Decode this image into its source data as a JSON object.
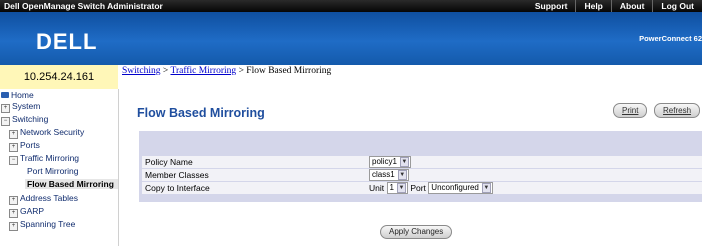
{
  "topbar": {
    "app_title": "Dell OpenManage Switch Administrator",
    "links": [
      "Support",
      "Help",
      "About",
      "Log Out"
    ]
  },
  "brand": {
    "logo": "DELL",
    "product": "PowerConnect 62"
  },
  "ip_address": "10.254.24.161",
  "breadcrumb": {
    "items": [
      "Switching",
      "Traffic Mirroring"
    ],
    "separator": ">",
    "current": "Flow Based Mirroring"
  },
  "tree": [
    {
      "label": "Home",
      "icon": "home-icon"
    },
    {
      "label": "System",
      "icon": "expand-icon"
    },
    {
      "label": "Switching",
      "icon": "collapse-icon"
    },
    {
      "label": "Network Security",
      "icon": "expand-icon"
    },
    {
      "label": "Ports",
      "icon": "expand-icon"
    },
    {
      "label": "Traffic Mirroring",
      "icon": "collapse-icon"
    },
    {
      "label": "Port Mirroring",
      "icon": "leaf-icon"
    },
    {
      "label": "Flow Based Mirroring",
      "icon": "leaf-icon",
      "selected": true
    },
    {
      "label": "Address Tables",
      "icon": "expand-icon"
    },
    {
      "label": "GARP",
      "icon": "expand-icon"
    },
    {
      "label": "Spanning Tree",
      "icon": "expand-icon"
    }
  ],
  "page": {
    "title": "Flow Based Mirroring",
    "print_label": "Print",
    "refresh_label": "Refresh",
    "apply_label": "Apply Changes"
  },
  "form": {
    "policy_name": {
      "label": "Policy Name",
      "value": "policy1"
    },
    "member_classes": {
      "label": "Member Classes",
      "value": "class1"
    },
    "copy_to_interface": {
      "label": "Copy to Interface",
      "unit_label": "Unit",
      "unit_value": "1",
      "port_label": "Port",
      "port_value": "Unconfigured"
    }
  },
  "colors": {
    "brand_blue": "#1f6cc6",
    "title_blue": "#1f4e9e",
    "ip_bg": "#fff7b8",
    "panel_bg": "#d4d6ea"
  }
}
